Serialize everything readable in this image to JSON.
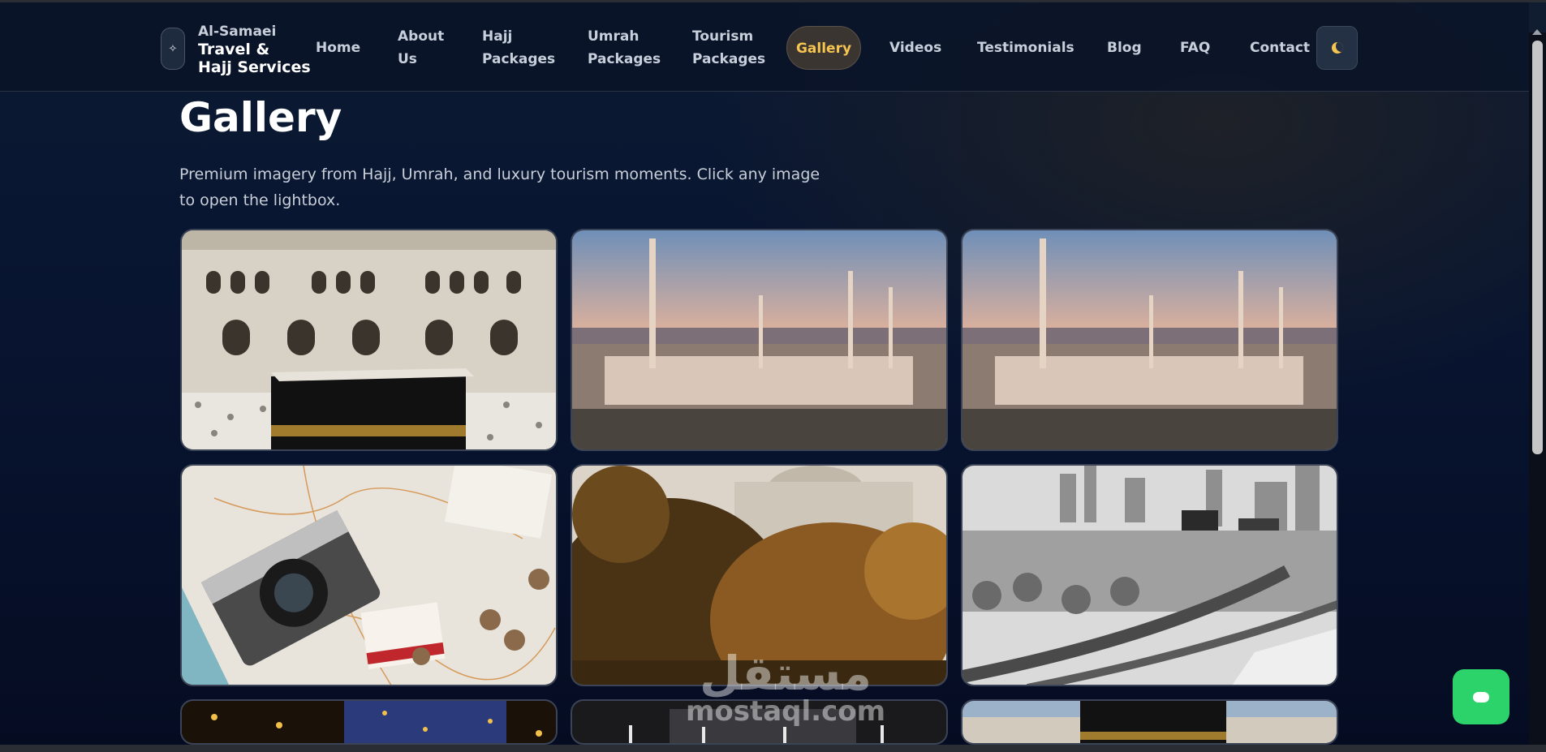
{
  "brand": {
    "line1": "Al-Samaei",
    "line2": "Travel &",
    "line3": "Hajj Services",
    "mark_icon": "diamond-icon"
  },
  "nav": {
    "items": [
      {
        "l1": "Home",
        "l2": ""
      },
      {
        "l1": "About",
        "l2": "Us"
      },
      {
        "l1": "Hajj",
        "l2": "Packages"
      },
      {
        "l1": "Umrah",
        "l2": "Packages"
      },
      {
        "l1": "Tourism",
        "l2": "Packages"
      },
      {
        "l1": "Gallery",
        "l2": ""
      },
      {
        "l1": "Videos",
        "l2": ""
      },
      {
        "l1": "Testimonials",
        "l2": ""
      },
      {
        "l1": "Blog",
        "l2": ""
      },
      {
        "l1": "FAQ",
        "l2": ""
      },
      {
        "l1": "Contact",
        "l2": ""
      }
    ],
    "active": "Gallery",
    "theme_icon": "moon-icon"
  },
  "page": {
    "title": "Gallery",
    "description": "Premium imagery from Hajj, Umrah, and luxury tourism moments. Click any image to open the lightbox."
  },
  "gallery": [
    {
      "subject": "kaaba-courtyard-photo"
    },
    {
      "subject": "prophets-mosque-sunset-photo"
    },
    {
      "subject": "prophets-mosque-sunset-photo"
    },
    {
      "subject": "camera-map-coins-photo"
    },
    {
      "subject": "mosque-behind-trees-photo"
    },
    {
      "subject": "city-skyline-highway-photo"
    },
    {
      "subject": "night-lights-photo"
    },
    {
      "subject": "mosque-night-photo"
    },
    {
      "subject": "kaaba-panorama-photo"
    }
  ],
  "watermark": {
    "arabic": "مستقل",
    "latin": "mostaql.com"
  },
  "colors": {
    "accent": "#f5c451",
    "chat": "#2bd36a",
    "background": "#081430"
  }
}
